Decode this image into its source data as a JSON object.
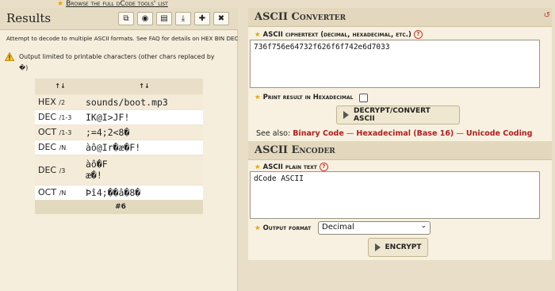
{
  "top_link": {
    "text": "Browse the full dCode tools' list"
  },
  "results": {
    "title": "Results",
    "tool_icons": [
      "copy-icon",
      "screenshot-icon",
      "print-icon",
      "download-icon",
      "pin-icon",
      "close-icon"
    ],
    "info": "Attempt to decode to multiple ASCII formats. See FAQ for details on HEX BIN DEC",
    "warning": "Output limited to printable characters (other chars replaced by",
    "warning_tail": ")",
    "tofu": "�",
    "sort_header_1": "↑↓",
    "sort_header_2": "↑↓",
    "rows": [
      {
        "format": "HEX",
        "sub": "/2",
        "value": "sounds/boot.mp3"
      },
      {
        "format": "DEC",
        "sub": "/1-3",
        "value": "IK@I>JF!"
      },
      {
        "format": "OCT",
        "sub": "/1-3",
        "value": ";=4;2<8�"
      },
      {
        "format": "DEC",
        "sub": "/N",
        "value": "àô@Ir�æ�F!"
      },
      {
        "format": "DEC",
        "sub": "/3",
        "value": "àô�F\næ�!"
      },
      {
        "format": "OCT",
        "sub": "/N",
        "value": "Þî4;��â�8�"
      }
    ],
    "more_label": "#6"
  },
  "converter": {
    "title": "ASCII Converter",
    "ciphertext_label": "ASCII ciphertext (decimal, hexadecimal, etc.)",
    "ciphertext_value": "736f756e64732f626f6f742e6d7033",
    "print_hex_label": "Print result in Hexadecimal",
    "decrypt_button": "DECRYPT/CONVERT ASCII",
    "see_also_label": "See also:",
    "see_also_links": [
      "Binary Code",
      "Hexadecimal (Base 16)",
      "Unicode Coding"
    ]
  },
  "encoder": {
    "title": "ASCII Encoder",
    "plaintext_label": "ASCII plain text",
    "plaintext_value": "dCode ASCII",
    "output_format_label": "Output format",
    "output_format_value": "Decimal",
    "encrypt_button": "ENCRYPT"
  },
  "colors": {
    "accent_red": "#b01e1e",
    "star": "#e8a400",
    "panel_bg": "#f8f1e1"
  }
}
